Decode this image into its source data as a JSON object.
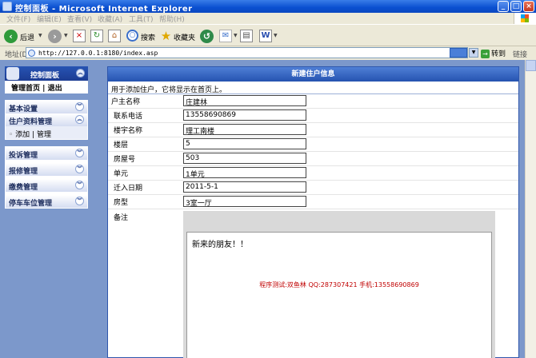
{
  "window": {
    "title": "控制面板 - Microsoft Internet Explorer",
    "buttons": {
      "minimize": "_",
      "maximize": "□",
      "close": "×"
    }
  },
  "menubar": [
    "文件(F)",
    "编辑(E)",
    "查看(V)",
    "收藏(A)",
    "工具(T)",
    "帮助(H)"
  ],
  "toolbar": {
    "back_label": "后退",
    "search_label": "搜索",
    "favorites_label": "收藏夹",
    "icons": [
      "back-icon",
      "forward-icon",
      "stop-icon",
      "refresh-icon",
      "home-icon",
      "search-icon",
      "favorites-icon",
      "media-icon",
      "mail-icon",
      "print-icon",
      "word-icon"
    ]
  },
  "address": {
    "label": "地址(D)",
    "url": "http://127.0.0.1:8180/index.asp",
    "go_label": "转到",
    "links_label": "链接"
  },
  "sidebar": {
    "header": "控制面板",
    "home_link": "管理首页",
    "separator": "|",
    "logout_link": "退出",
    "sections": [
      {
        "title": "基本设置"
      },
      {
        "title": "住户资料管理",
        "add": "添加",
        "manage": "管理"
      },
      {
        "title": "投诉管理"
      },
      {
        "title": "报修管理"
      },
      {
        "title": "缴费管理"
      },
      {
        "title": "停车车位管理"
      }
    ]
  },
  "form": {
    "title": "新建住户信息",
    "intro": "用于添加住户，它将显示在首页上。",
    "fields": [
      {
        "label": "户主名称",
        "value": "庄建林"
      },
      {
        "label": "联系电话",
        "value": "13558690869"
      },
      {
        "label": "楼宇名称",
        "value": "理工南楼"
      },
      {
        "label": "楼层",
        "value": "5"
      },
      {
        "label": "房屋号",
        "value": "503"
      },
      {
        "label": "单元",
        "value": "1单元"
      },
      {
        "label": "迁入日期",
        "value": "2011-5-1"
      },
      {
        "label": "房型",
        "value": "3室一厅"
      }
    ],
    "notes_label": "备注",
    "notes_content": "新来的朋友！！",
    "credit": "程序测试:双鱼林 QQ:287307421 手机:13558690869"
  }
}
